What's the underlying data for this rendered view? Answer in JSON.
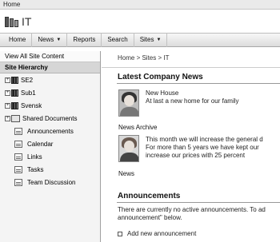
{
  "topbar": {
    "home_link": "Home"
  },
  "site": {
    "title": "IT"
  },
  "nav": {
    "items": [
      {
        "label": "Home",
        "dropdown": false
      },
      {
        "label": "News",
        "dropdown": true
      },
      {
        "label": "Reports",
        "dropdown": false
      },
      {
        "label": "Search",
        "dropdown": false
      },
      {
        "label": "Sites",
        "dropdown": true
      }
    ]
  },
  "sidebar": {
    "view_all": "View All Site Content",
    "hierarchy_header": "Site Hierarchy",
    "sites": [
      {
        "label": "SE2",
        "expander": "+"
      },
      {
        "label": "Sub1",
        "expander": "+"
      },
      {
        "label": "Svensk",
        "expander": "+"
      },
      {
        "label": "Shared Documents",
        "expander": "+"
      }
    ],
    "lists": [
      {
        "label": "Announcements"
      },
      {
        "label": "Calendar"
      },
      {
        "label": "Links"
      },
      {
        "label": "Tasks"
      },
      {
        "label": "Team Discussion"
      }
    ]
  },
  "breadcrumb": {
    "text": "Home > Sites > IT"
  },
  "news": {
    "title": "Latest Company News",
    "items": [
      {
        "headline": "New House",
        "body": "At last a new home for our family",
        "link": "News Archive"
      },
      {
        "body_lines": [
          "This month we will increase the general d",
          "For more than 5 years we have kept our",
          "increase our prices with 25 percent"
        ],
        "link": "News"
      }
    ]
  },
  "announcements": {
    "title": "Announcements",
    "empty_lines": [
      "There are currently no active announcements. To ad",
      "announcement\" below."
    ],
    "add_label": "Add new announcement"
  }
}
